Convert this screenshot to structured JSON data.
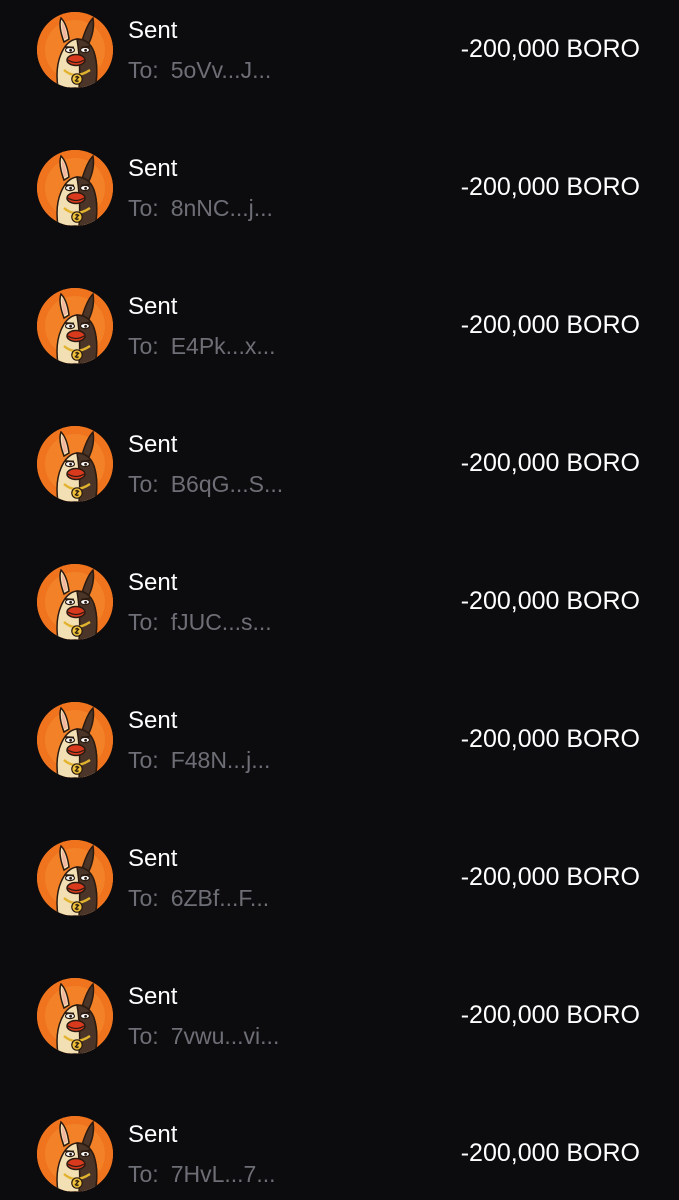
{
  "colors": {
    "background": "#0c0c0f",
    "primary_text": "#ffffff",
    "secondary_text": "#6e6f76",
    "avatar_bg": "#f0741e"
  },
  "avatar_icon": "boro-mascot-avatar",
  "transactions": [
    {
      "title": "Sent",
      "to_prefix": "To:",
      "to_address": "5oVv...J...",
      "amount": "-200,000 BORO"
    },
    {
      "title": "Sent",
      "to_prefix": "To:",
      "to_address": "8nNC...j...",
      "amount": "-200,000 BORO"
    },
    {
      "title": "Sent",
      "to_prefix": "To:",
      "to_address": "E4Pk...x...",
      "amount": "-200,000 BORO"
    },
    {
      "title": "Sent",
      "to_prefix": "To:",
      "to_address": "B6qG...S...",
      "amount": "-200,000 BORO"
    },
    {
      "title": "Sent",
      "to_prefix": "To:",
      "to_address": "fJUC...s...",
      "amount": "-200,000 BORO"
    },
    {
      "title": "Sent",
      "to_prefix": "To:",
      "to_address": "F48N...j...",
      "amount": "-200,000 BORO"
    },
    {
      "title": "Sent",
      "to_prefix": "To:",
      "to_address": "6ZBf...F...",
      "amount": "-200,000 BORO"
    },
    {
      "title": "Sent",
      "to_prefix": "To:",
      "to_address": "7vwu...vi...",
      "amount": "-200,000 BORO"
    },
    {
      "title": "Sent",
      "to_prefix": "To:",
      "to_address": "7HvL...7...",
      "amount": "-200,000 BORO"
    }
  ]
}
